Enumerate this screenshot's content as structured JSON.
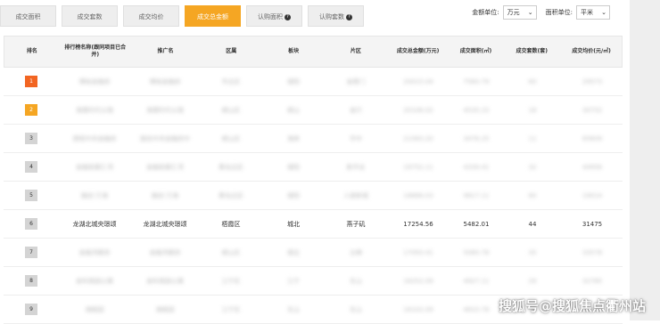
{
  "tabs": [
    {
      "label": "成交面积",
      "active": false,
      "help": false
    },
    {
      "label": "成交套数",
      "active": false,
      "help": false
    },
    {
      "label": "成交均价",
      "active": false,
      "help": false
    },
    {
      "label": "成交总金额",
      "active": true,
      "help": false
    },
    {
      "label": "认购面积",
      "active": false,
      "help": true
    },
    {
      "label": "认购套数",
      "active": false,
      "help": true
    }
  ],
  "units": {
    "amount_label": "金额单位:",
    "amount_value": "万元",
    "area_label": "面积单位:",
    "area_value": "平米"
  },
  "table": {
    "headers": [
      "排名",
      "排行榜名称(跟同项目已合并)",
      "推广名",
      "区属",
      "板块",
      "片区",
      "成交总金额(万元)",
      "成交面积(㎡)",
      "成交套数(套)",
      "成交均价(元/㎡)"
    ],
    "rows": [
      {
        "rank": "1",
        "cells": [
          "博裕金融府",
          "博裕金融府",
          "市北区",
          "城阳",
          "金鼎门",
          "20015.04",
          "7560.79",
          "60",
          "29573"
        ]
      },
      {
        "rank": "2",
        "cells": [
          "海慧时代公馆",
          "海慧时代公馆",
          "崂山区",
          "崂山",
          "金行",
          "20106.02",
          "4535.23",
          "18",
          "30752"
        ]
      },
      {
        "rank": "3",
        "cells": [
          "德昭中央金融府",
          "国信中央金融府中",
          "崂山区",
          "海岸",
          "华中",
          "21583.20",
          "3476.25",
          "11",
          "65609"
        ]
      },
      {
        "rank": "4",
        "cells": [
          "金融街都汇湾",
          "金融街都汇湾",
          "黄岛北区",
          "城阳",
          "新华业",
          "19752.11",
          "4339.41",
          "32",
          "44956"
        ]
      },
      {
        "rank": "5",
        "cells": [
          "融创·万海",
          "融创·万海",
          "黄岛北区",
          "城阳",
          "人居新城",
          "18666.03",
          "9817.11",
          "80",
          "19014"
        ]
      },
      {
        "rank": "6",
        "cells": [
          "龙湖北城央璟颂",
          "龙湖北城央璟颂",
          "梧霞区",
          "城北",
          "燕子矶",
          "17254.56",
          "5482.01",
          "44",
          "31475"
        ]
      },
      {
        "rank": "7",
        "cells": [
          "金融湾都府",
          "金融湾都府",
          "崂山区",
          "城北",
          "五峰",
          "17093.41",
          "5080.78",
          "35",
          "33578"
        ]
      },
      {
        "rank": "8",
        "cells": [
          "金科观园公寓",
          "金科观园公寓",
          "江宁区",
          "江宁",
          "东山",
          "16252.09",
          "4927.11",
          "29",
          "32785"
        ]
      },
      {
        "rank": "9",
        "cells": [
          "海赋园",
          "海赋园",
          "江宁区",
          "东山",
          "东山",
          "16102.09",
          "4810.78",
          "36",
          "33478"
        ]
      }
    ],
    "clear_rank": "6"
  },
  "watermark": "搜狐号@搜狐焦点衢州站"
}
